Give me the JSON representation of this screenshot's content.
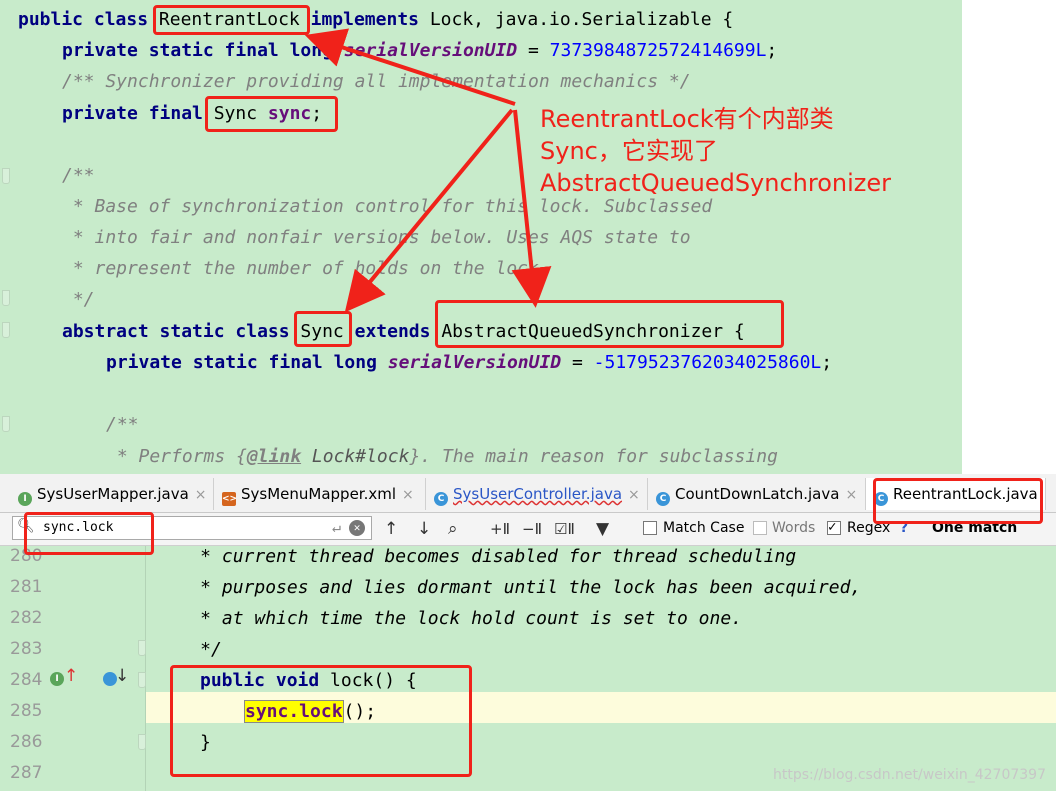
{
  "top_code": {
    "l1": {
      "kw1": "public class ",
      "cls": "ReentrantLock",
      "kw2": " implements ",
      "rest": "Lock, java.io.Serializable {"
    },
    "l2": {
      "kw": "private static final long ",
      "field": "serialVersionUID",
      "eq": " = ",
      "num": "7373984872572414699L",
      ";": ";"
    },
    "l3": "/** Synchronizer providing all implementation mechanics */",
    "l4": {
      "kw": "private final ",
      "type": "Sync ",
      "field": "sync",
      "end": ";"
    },
    "l6": "/**",
    "l7": " * Base of synchronization control for this lock. Subclassed",
    "l8": " * into fair and nonfair versions below. Uses AQS state to",
    "l9": " * represent the number of holds on the lock.",
    "l10": " */",
    "l11": {
      "kw1": "abstract static class ",
      "cls": "Sync",
      "kw2": " extends ",
      "sup": "AbstractQueuedSynchronizer",
      "end": " {"
    },
    "l12": {
      "kw": "private static final long ",
      "field": "serialVersionUID",
      "eq": " = ",
      "num": "-5179523762034025860L",
      "end": ";"
    },
    "l14": "/**",
    "l15": {
      "a": " * Performs {",
      "tag": "@link",
      "b": " Lock#lock",
      "c": "}. The main reason for subclassing"
    }
  },
  "callout": {
    "line1": "ReentrantLock有个内部类",
    "line2": "Sync，它实现了",
    "line3": "AbstractQueuedSynchronizer"
  },
  "tabs": [
    {
      "label": "SysUserMapper.java",
      "icon": "interface-icon"
    },
    {
      "label": "SysMenuMapper.xml",
      "icon": "xml-file-icon"
    },
    {
      "label": "SysUserController.java",
      "icon": "class-icon"
    },
    {
      "label": "CountDownLatch.java",
      "icon": "class-icon"
    },
    {
      "label": "ReentrantLock.java",
      "icon": "class-icon",
      "active": true
    }
  ],
  "search": {
    "query": "sync.lock",
    "match_case": "Match Case",
    "words": "Words",
    "regex": "Regex",
    "help": "?",
    "result": "One match",
    "match_case_checked": false,
    "words_checked": false,
    "regex_checked": true
  },
  "editor": {
    "lines": [
      {
        "n": "280",
        "text": "     * current thread becomes disabled for thread scheduling"
      },
      {
        "n": "281",
        "text": "     * purposes and lies dormant until the lock has been acquired,"
      },
      {
        "n": "282",
        "text": "     * at which time the lock hold count is set to one."
      },
      {
        "n": "283",
        "text": "     */"
      },
      {
        "n": "284",
        "kw": "public void ",
        "name": "lock() {"
      },
      {
        "n": "285",
        "hl": "sync.lock",
        "rest": "();"
      },
      {
        "n": "286",
        "text": "}"
      },
      {
        "n": "287",
        "text": ""
      }
    ]
  },
  "watermark": "https://blog.csdn.net/weixin_42707397",
  "colors": {
    "annotation_red": "#f0221a",
    "editor_bg": "#c8ebcb",
    "keyword": "#000080",
    "search_highlight": "#ffff00"
  }
}
